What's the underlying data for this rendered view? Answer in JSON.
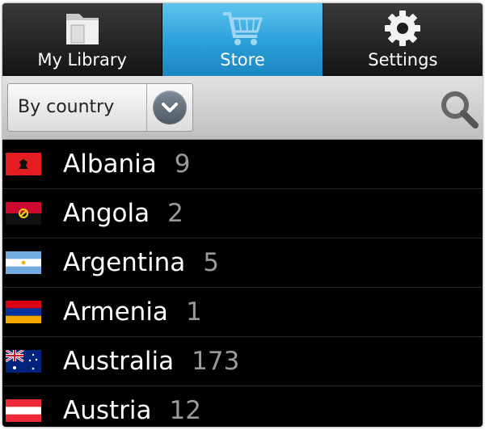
{
  "tabs": [
    {
      "label": "My Library",
      "icon": "folder-icon",
      "active": false
    },
    {
      "label": "Store",
      "icon": "cart-icon",
      "active": true
    },
    {
      "label": "Settings",
      "icon": "gear-icon",
      "active": false
    }
  ],
  "filter": {
    "selected": "By country"
  },
  "colors": {
    "active_tab": "#2a9fd8",
    "list_bg": "#000000",
    "count_text": "#9a9a9a"
  },
  "countries": [
    {
      "name": "Albania",
      "count": "9",
      "flag": "albania-flag"
    },
    {
      "name": "Angola",
      "count": "2",
      "flag": "angola-flag"
    },
    {
      "name": "Argentina",
      "count": "5",
      "flag": "argentina-flag"
    },
    {
      "name": "Armenia",
      "count": "1",
      "flag": "armenia-flag"
    },
    {
      "name": "Australia",
      "count": "173",
      "flag": "australia-flag"
    },
    {
      "name": "Austria",
      "count": "12",
      "flag": "austria-flag"
    }
  ]
}
